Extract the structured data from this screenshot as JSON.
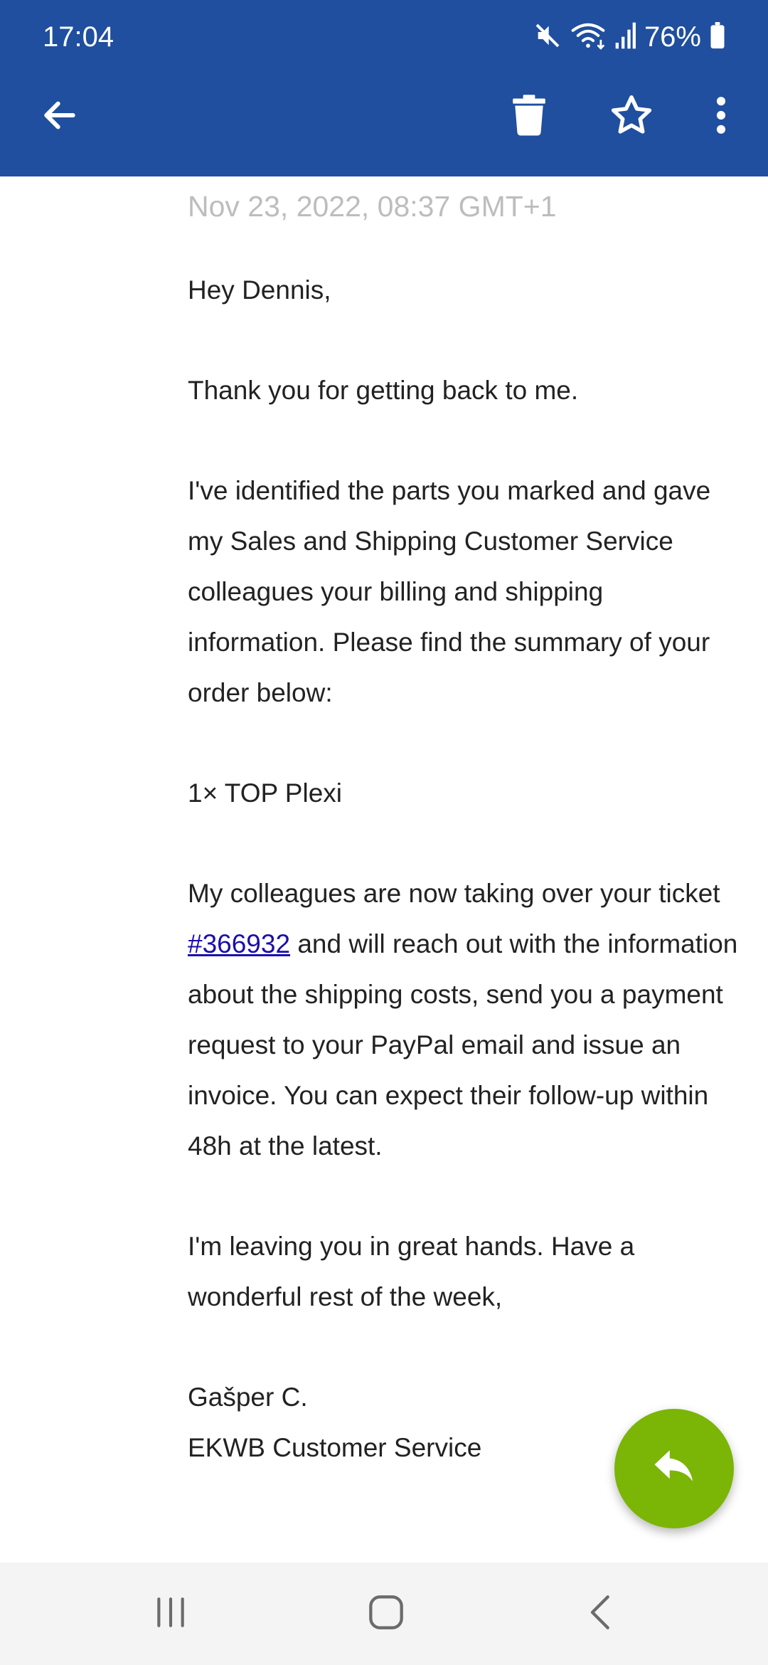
{
  "status_bar": {
    "time": "17:04",
    "battery_percent": "76%",
    "icons": [
      "mute-icon",
      "wifi-icon",
      "signal-icon",
      "battery-icon"
    ]
  },
  "toolbar": {
    "icons": [
      "back-arrow-icon",
      "trash-icon",
      "star-outline-icon",
      "more-vert-icon"
    ]
  },
  "email": {
    "date": "Nov 23, 2022, 08:37 GMT+1",
    "greeting": "Hey Dennis,",
    "p1": "Thank you for getting back to me.",
    "p2": "I've identified the parts you marked and gave my Sales and Shipping Customer Service colleagues your billing and shipping information. Please find the summary of your order below:",
    "order_item": "1× TOP Plexi",
    "p3_before": "My colleagues are now taking over your ticket ",
    "ticket_link": "#366932",
    "p3_after": " and will reach out with the information about the shipping costs, send you a payment request to your PayPal email and issue an invoice. You can expect their follow-up within 48h at the latest.",
    "p4": "I'm leaving you in great hands. Have a wonderful rest of the week,",
    "signature_name": "Gašper C.",
    "signature_team": "EKWB Customer Service"
  },
  "fab": {
    "icon": "reply-icon",
    "color": "#7bb505"
  },
  "nav_bar": {
    "icons": [
      "recent-apps-icon",
      "home-icon",
      "nav-back-icon"
    ]
  },
  "colors": {
    "appbar": "#1f4f9e",
    "link": "#1a0dab",
    "date": "#bdbdbd"
  }
}
